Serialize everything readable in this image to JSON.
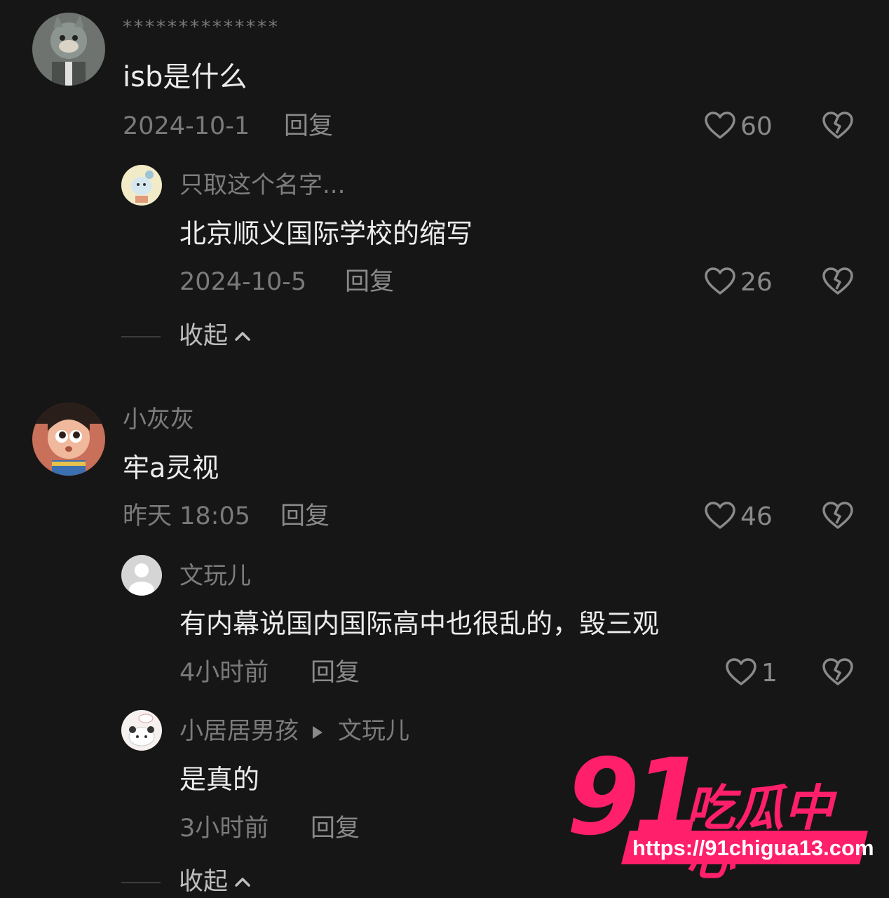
{
  "comments": [
    {
      "user": "**************",
      "text": "isb是什么",
      "date": "2024-10-1",
      "reply_label": "回复",
      "likes": "60",
      "replies": [
        {
          "user": "只取这个名字...",
          "text": "北京顺义国际学校的缩写",
          "date": "2024-10-5",
          "reply_label": "回复",
          "likes": "26"
        }
      ],
      "collapse_label": "收起"
    },
    {
      "user": "小灰灰",
      "text": "牢a灵视",
      "date": "昨天 18:05",
      "reply_label": "回复",
      "likes": "46",
      "replies": [
        {
          "user": "文玩儿",
          "text": "有内幕说国内国际高中也很乱的，毁三观",
          "date": "4小时前",
          "reply_label": "回复",
          "likes": "1"
        },
        {
          "user": "小居居男孩",
          "reply_to": "文玩儿",
          "text": "是真的",
          "date": "3小时前",
          "reply_label": "回复"
        }
      ],
      "collapse_label": "收起"
    }
  ],
  "watermark": {
    "number": "91",
    "text": "吃瓜中心",
    "url": "https://91chigua13.com"
  },
  "colors": {
    "background": "#161616",
    "watermark": "#ff1f6b"
  },
  "icons": [
    "heart-outline-icon",
    "broken-heart-icon",
    "chevron-up-icon",
    "reply-arrow-icon"
  ]
}
